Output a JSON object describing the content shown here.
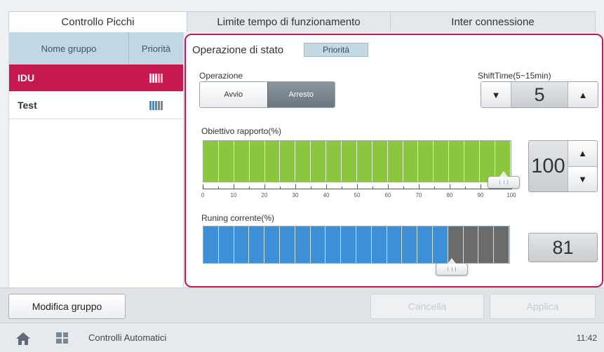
{
  "tabs": [
    {
      "label": "Controllo Picchi",
      "active": true
    },
    {
      "label": "Limite tempo di funzionamento",
      "active": false
    },
    {
      "label": "Inter connessione",
      "active": false
    }
  ],
  "group_list": {
    "headers": {
      "name": "Nome gruppo",
      "priority": "Priorità"
    },
    "rows": [
      {
        "name": "IDU",
        "selected": true,
        "priority_level": 3
      },
      {
        "name": "Test",
        "selected": false,
        "priority_level": 3
      }
    ]
  },
  "state": {
    "title": "Operazione di stato",
    "badge": "Priorità"
  },
  "operation": {
    "label": "Operazione",
    "options": [
      "Avvio",
      "Arresto"
    ],
    "selected": "Arresto"
  },
  "shift_time": {
    "label": "ShiftTime(5~15min)",
    "value": "5",
    "down_icon": "triangle-down-icon",
    "up_icon": "triangle-up-icon"
  },
  "target_ratio": {
    "label": "Obiettivo rapporto(%)",
    "value": "100",
    "percent": 100,
    "ticks": [
      "0",
      "10",
      "20",
      "30",
      "40",
      "50",
      "60",
      "70",
      "80",
      "90",
      "100"
    ]
  },
  "running_current": {
    "label": "Runing corrente(%)",
    "value": "81",
    "percent": 81
  },
  "actions": {
    "edit_group": "Modifica gruppo",
    "cancel": "Cancella",
    "apply": "Applica"
  },
  "status_bar": {
    "title": "Controlli Automatici",
    "time": "11:42"
  },
  "colors": {
    "accent": "#c51950",
    "green": "#8cc63f",
    "blue": "#3d8fd8",
    "gray": "#6b6b6b"
  }
}
